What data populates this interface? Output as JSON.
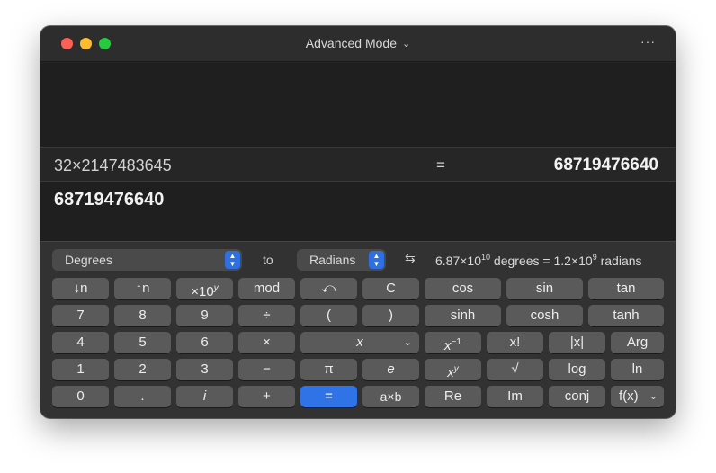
{
  "window": {
    "title": "Advanced Mode",
    "more": "···",
    "colors": {
      "close": "#fe5f57",
      "minimize": "#febc2e",
      "maximize": "#28c840",
      "accent": "#2f73e6"
    }
  },
  "display": {
    "expression": "32×2147483645",
    "equals": "=",
    "result": "68719476640",
    "input": "68719476640"
  },
  "conversion": {
    "from_unit": "Degrees",
    "to_label": "to",
    "to_unit": "Radians",
    "swap_icon": "⇆",
    "result_from_mantissa": "6.87×10",
    "result_from_exp": "10",
    "result_from_unit": "degrees",
    "result_eq": "=",
    "result_to_mantissa": "1.2×10",
    "result_to_exp": "9",
    "result_to_unit": "radians"
  },
  "keys": {
    "round_down": "↓n",
    "round_up": "↑n",
    "sci_base": "×10",
    "sci_exp": "y",
    "mod": "mod",
    "undo": "⤺",
    "clear": "C",
    "cos": "cos",
    "sin": "sin",
    "tan": "tan",
    "k7": "7",
    "k8": "8",
    "k9": "9",
    "divide": "÷",
    "lparen": "(",
    "rparen": ")",
    "sinh": "sinh",
    "cosh": "cosh",
    "tanh": "tanh",
    "k4": "4",
    "k5": "5",
    "k6": "6",
    "multiply": "×",
    "var_x": "x",
    "dropdown": "⌄",
    "recip_base": "x",
    "recip_exp": "−1",
    "factorial": "x!",
    "abs": "|x|",
    "arg": "Arg",
    "k1": "1",
    "k2": "2",
    "k3": "3",
    "minus": "−",
    "pi": "π",
    "e": "e",
    "pow_base": "x",
    "pow_exp": "y",
    "sqrt": "√",
    "log": "log",
    "ln": "ln",
    "k0": "0",
    "dot": ".",
    "imag": "i",
    "plus": "+",
    "equals": "=",
    "mul_ab": "a×b",
    "re": "Re",
    "im": "Im",
    "conj": "conj",
    "fx": "f(x)"
  }
}
